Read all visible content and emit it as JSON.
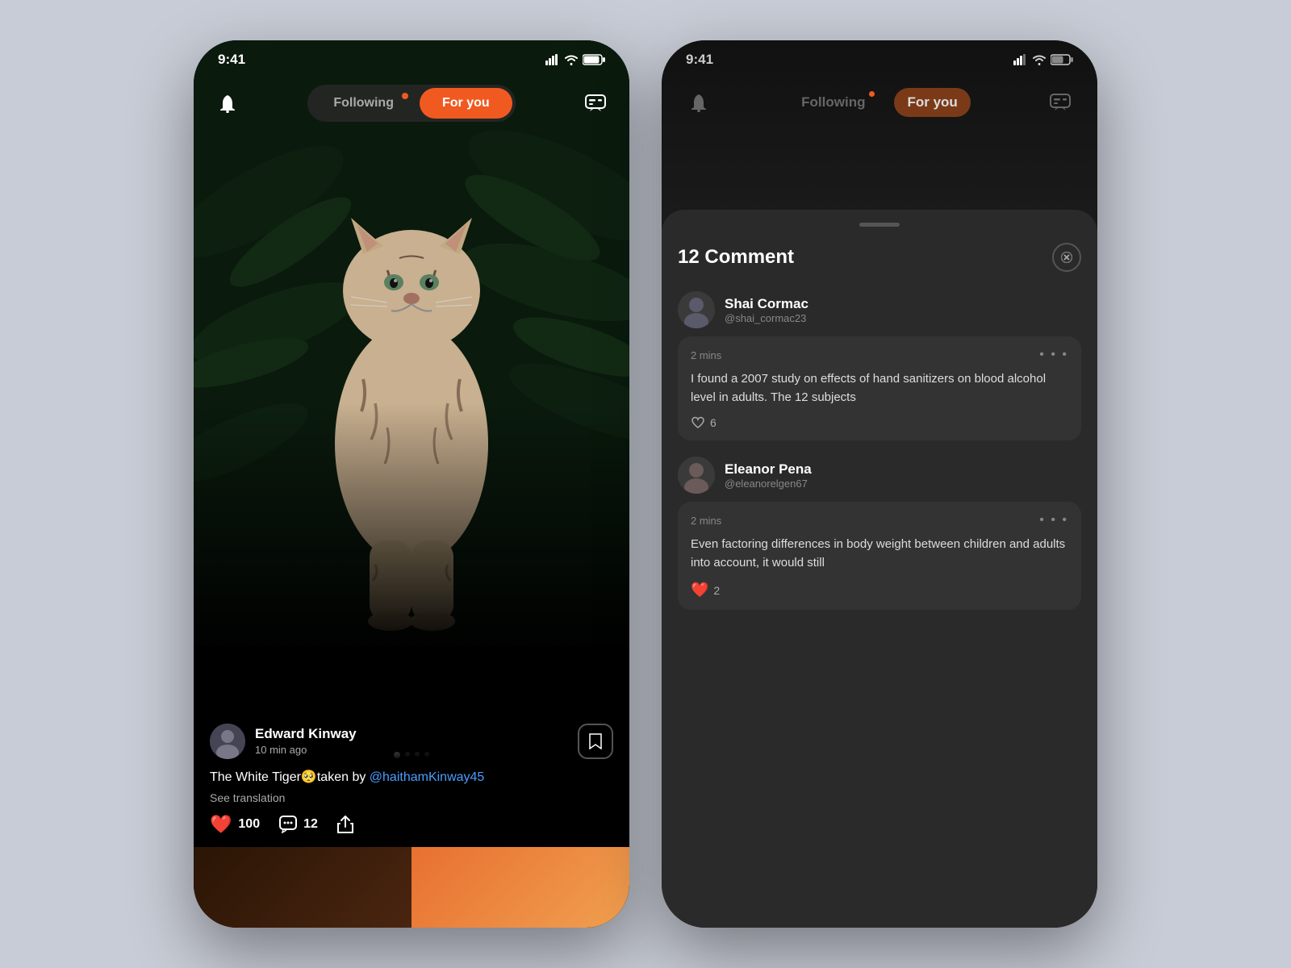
{
  "phone1": {
    "status": {
      "time": "9:41"
    },
    "nav": {
      "following_label": "Following",
      "foryou_label": "For you"
    },
    "post": {
      "author_name": "Edward Kinway",
      "author_time": "10 min ago",
      "caption": "The White Tiger🥺taken by ",
      "mention": "@haithamKinway45",
      "see_translation": "See translation",
      "likes_count": "100",
      "comments_count": "12"
    }
  },
  "phone2": {
    "status": {
      "time": "9:41"
    },
    "nav": {
      "following_label": "Following",
      "foryou_label": "For you"
    },
    "comments": {
      "title": "12 Comment",
      "comment1": {
        "user_name": "Shai Cormac",
        "user_handle": "@shai_cormac23",
        "time": "2 mins",
        "text": "I found a 2007 study on effects of hand sanitizers on blood alcohol level in adults. The 12 subjects",
        "likes": "6"
      },
      "comment2": {
        "user_name": "Eleanor Pena",
        "user_handle": "@eleanorelgen67",
        "time": "2 mins",
        "text": "Even factoring differences in body weight between children and adults into account, it would still",
        "likes": "2"
      }
    }
  }
}
